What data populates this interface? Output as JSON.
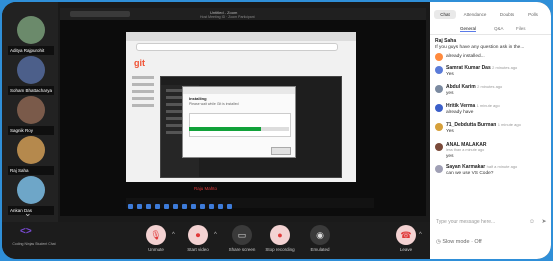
{
  "participants": [
    {
      "name": "Aditya Rajpurohit",
      "color": "#6b8a6b"
    },
    {
      "name": "Soham Bhattacharya",
      "color": "#4c5f8a"
    },
    {
      "name": "Sagnik Roy",
      "color": "#7a5a4a"
    },
    {
      "name": "Raj Saha",
      "color": "#b5894d"
    },
    {
      "name": "Ankan Das",
      "color": "#6ea6c8"
    }
  ],
  "screen": {
    "window_title": "Untitled - Zoom",
    "subtitle": "Host Meeting ID · Zoom Participant",
    "installer_title": "Installing",
    "installer_subtitle": "Please wait while Git is installed",
    "progress": 0.72,
    "red_caption": "Raju Mahto",
    "logo_letter": "git"
  },
  "chat": {
    "tabs": [
      "Chat",
      "Attendance",
      "Doubts",
      "Polls"
    ],
    "subtabs": [
      "General",
      "Q&A",
      "Files"
    ],
    "messages": [
      {
        "name": "Raj Saha",
        "time": "",
        "text": "If you guys have any question ask in the...",
        "icon": false
      },
      {
        "name": "",
        "time": "",
        "text": "already installed...",
        "icon": true,
        "color": "#ff8a3d"
      },
      {
        "name": "Samrat Kumar Das",
        "time": "2 minutes ago",
        "text": "Yes",
        "icon": true,
        "color": "#5a7bd8"
      },
      {
        "name": "Abdul Karim",
        "time": "2 minutes ago",
        "text": "yes",
        "icon": true,
        "color": "#7b8aa0"
      },
      {
        "name": "Hritik Verma",
        "time": "1 minute ago",
        "text": "already have",
        "icon": true,
        "color": "#3b5fc9"
      },
      {
        "name": "71_Debdutta Burman",
        "time": "1 minute ago",
        "text": "Yes",
        "icon": true,
        "color": "#d6a03b"
      },
      {
        "name": "ANAL MALAKAR",
        "time": "less than a minute ago",
        "text": "yes",
        "icon": true,
        "color": "#7a4a3a"
      },
      {
        "name": "Sayan Karmakar",
        "time": "half a minute ago",
        "text": "can we use VS Code?",
        "icon": true,
        "color": "#a0a0b5"
      }
    ],
    "input_placeholder": "Type your message here...",
    "slow_mode": "Slow mode · Off"
  },
  "toolbar": {
    "logo": "<>",
    "logo_sub": "Coding Ninjas Student Chat",
    "controls": [
      {
        "label": "Unmute",
        "glyph": "🎙"
      },
      {
        "label": "Start video",
        "glyph": "⏺"
      },
      {
        "label": "Share screen",
        "glyph": "▭"
      },
      {
        "label": "Stop recording",
        "glyph": "●"
      },
      {
        "label": "Emulated",
        "glyph": "◉"
      },
      {
        "label": "Leave",
        "glyph": "☎"
      }
    ]
  }
}
